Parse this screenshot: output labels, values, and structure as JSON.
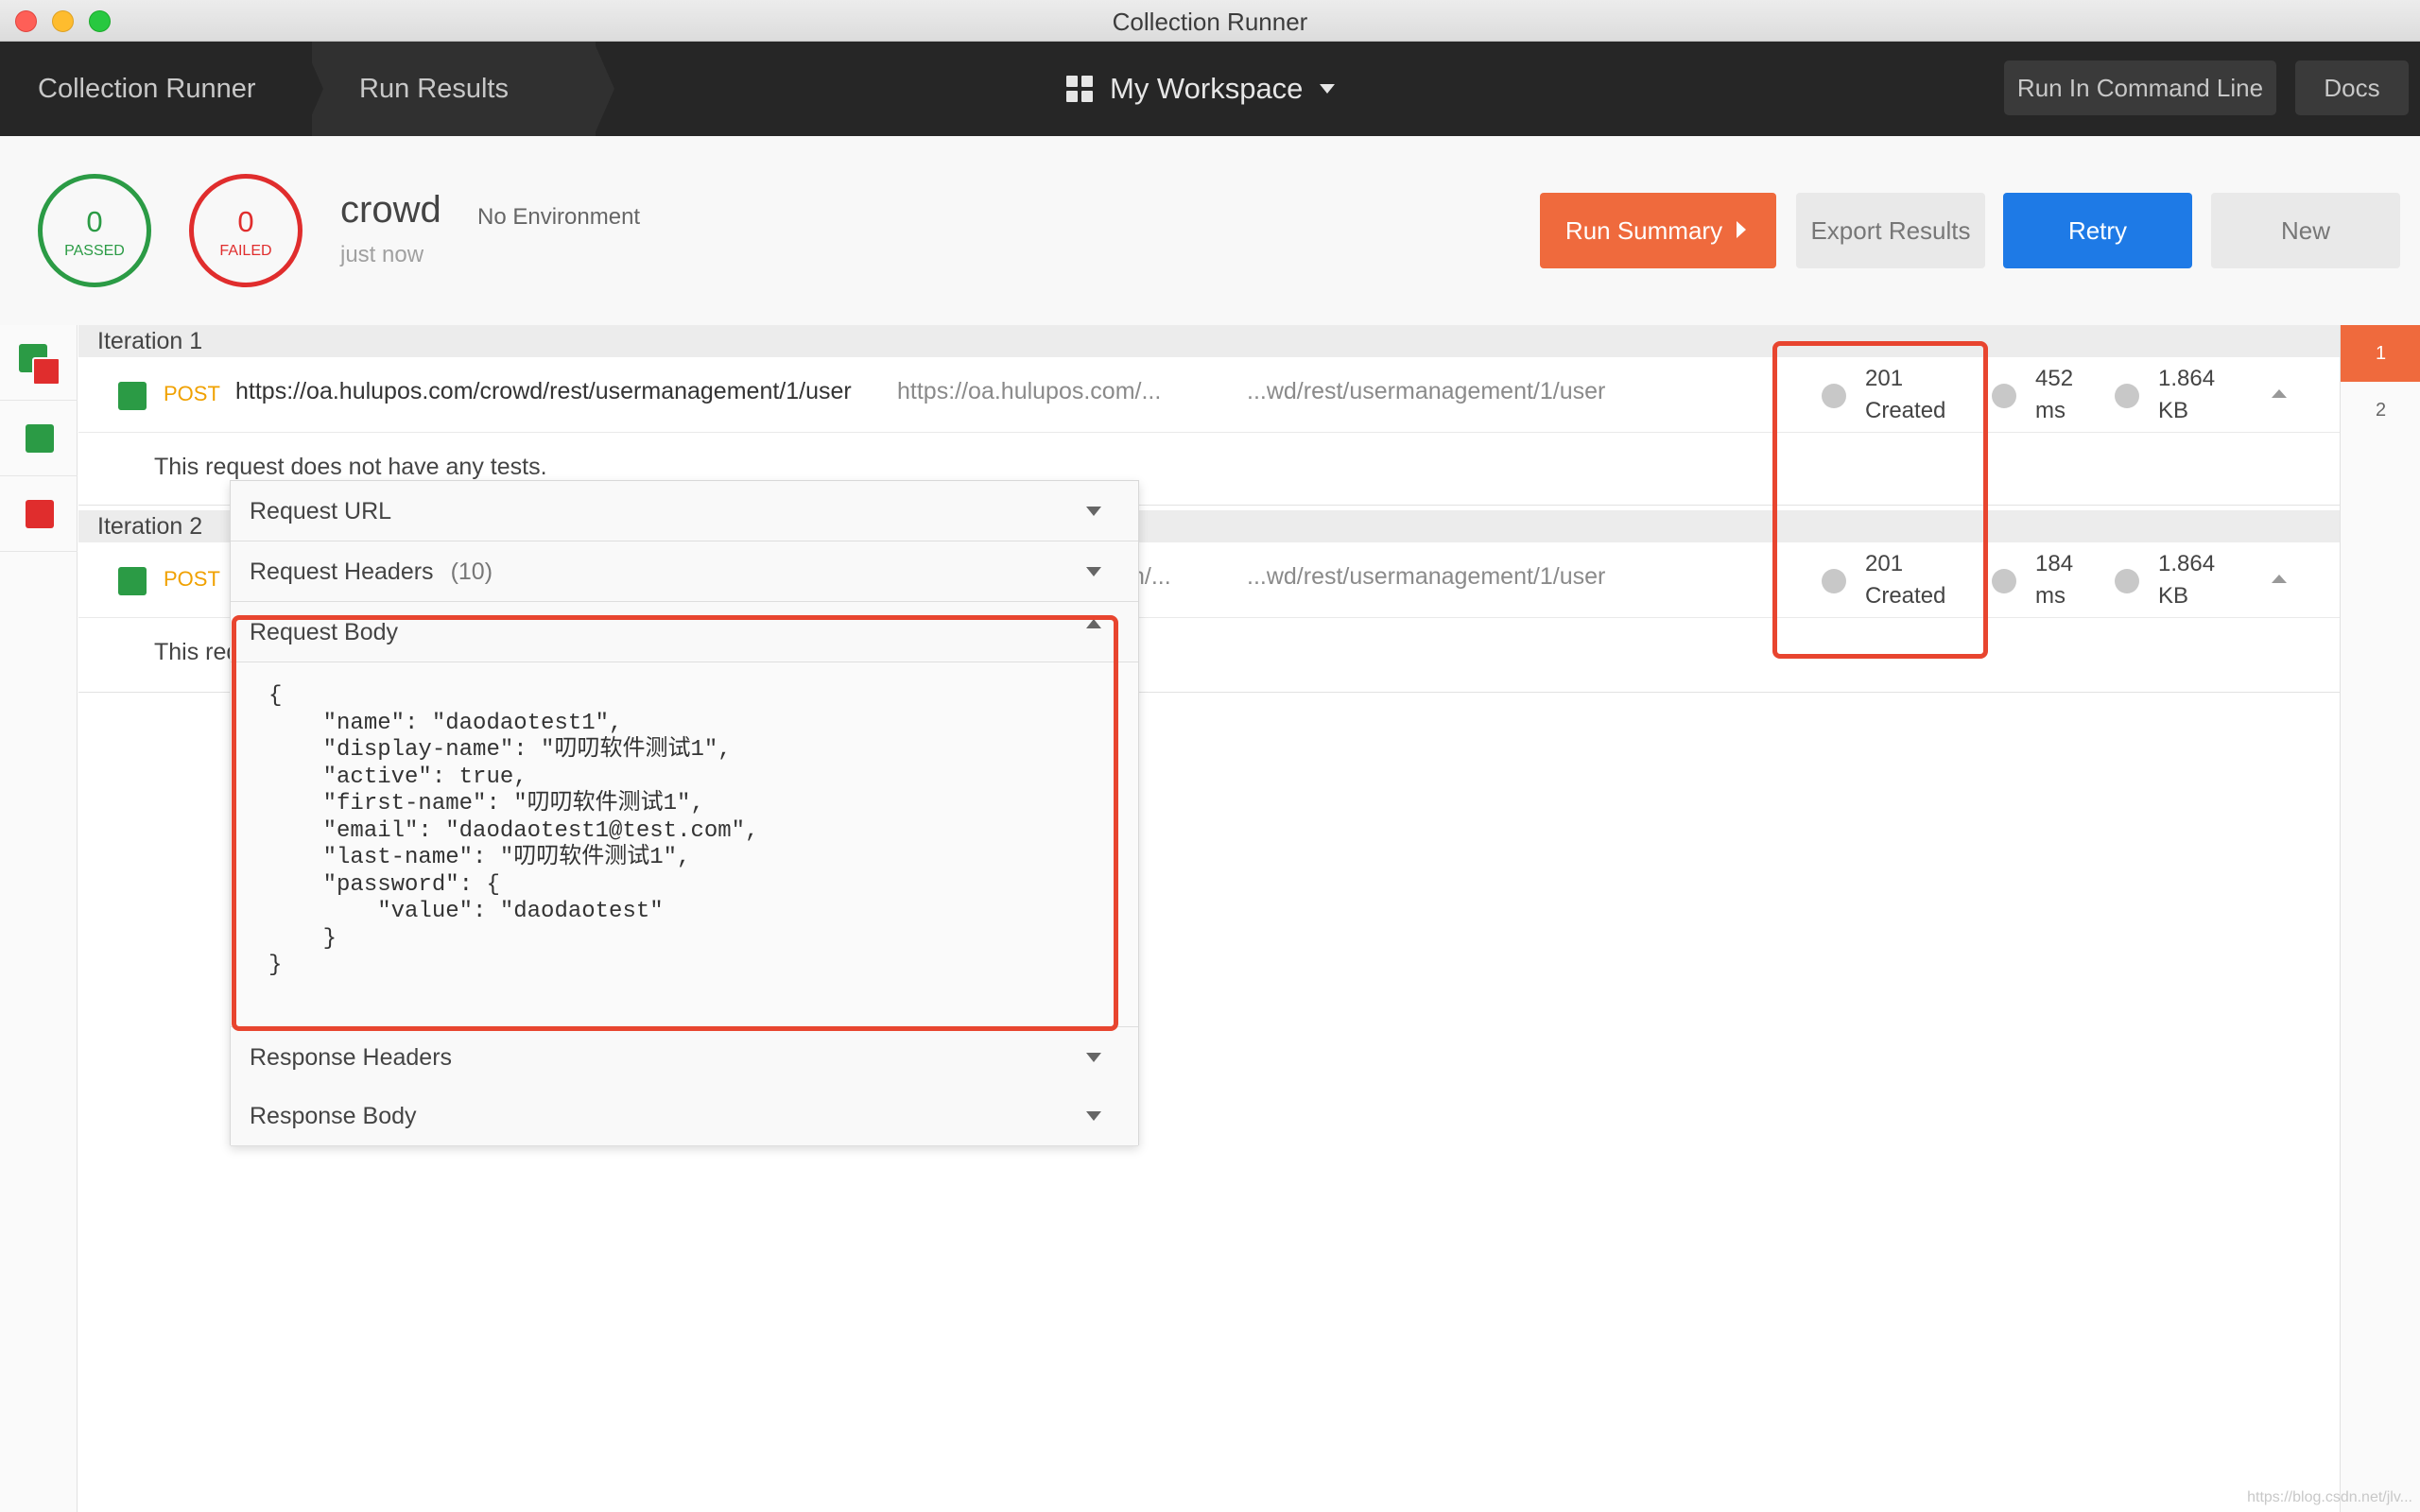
{
  "window": {
    "title": "Collection Runner"
  },
  "header": {
    "breadcrumbs": [
      "Collection Runner",
      "Run Results"
    ],
    "workspace": "My Workspace",
    "run_cli": "Run In Command Line",
    "docs": "Docs"
  },
  "summary": {
    "passed": {
      "count": "0",
      "label": "PASSED"
    },
    "failed": {
      "count": "0",
      "label": "FAILED"
    },
    "collection": "crowd",
    "environment": "No Environment",
    "time": "just now",
    "buttons": {
      "run_summary": "Run Summary",
      "export": "Export Results",
      "retry": "Retry",
      "new": "New"
    }
  },
  "iteration_nav": [
    "1",
    "2"
  ],
  "iterations": [
    {
      "title": "Iteration 1",
      "request": {
        "method": "POST",
        "url": "https://oa.hulupos.com/crowd/rest/usermanagement/1/user",
        "url_short_a": "https://oa.hulupos.com/...",
        "url_short_b": "...wd/rest/usermanagement/1/user",
        "status_code": "201",
        "status_text": "Created",
        "time_value": "452",
        "time_unit": "ms",
        "size_value": "1.864",
        "size_unit": "KB"
      },
      "tests_msg": "This request does not have any tests."
    },
    {
      "title": "Iteration 2",
      "request": {
        "method": "POST",
        "url_short_a": "n/...",
        "url_short_b": "...wd/rest/usermanagement/1/user",
        "status_code": "201",
        "status_text": "Created",
        "time_value": "184",
        "time_unit": "ms",
        "size_value": "1.864",
        "size_unit": "KB"
      },
      "tests_msg": "This req"
    }
  ],
  "details_panel": {
    "request_url": "Request URL",
    "request_headers": "Request Headers",
    "request_headers_count": "(10)",
    "request_body": "Request Body",
    "body_code": "{\n    \"name\": \"daodaotest1\",\n    \"display-name\": \"叨叨软件测试1\",\n    \"active\": true,\n    \"first-name\": \"叨叨软件测试1\",\n    \"email\": \"daodaotest1@test.com\",\n    \"last-name\": \"叨叨软件测试1\",\n    \"password\": {\n        \"value\": \"daodaotest\"\n    }\n}",
    "response_headers": "Response Headers",
    "response_body": "Response Body"
  },
  "watermark": "https://blog.csdn.net/jlv...",
  "colors": {
    "pass": "#2b9b45",
    "fail": "#e02d2d",
    "accent_orange": "#ef6a3d",
    "retry_blue": "#1e7ae6",
    "method_post": "#f0a100",
    "annotation_red": "#e8452f"
  }
}
